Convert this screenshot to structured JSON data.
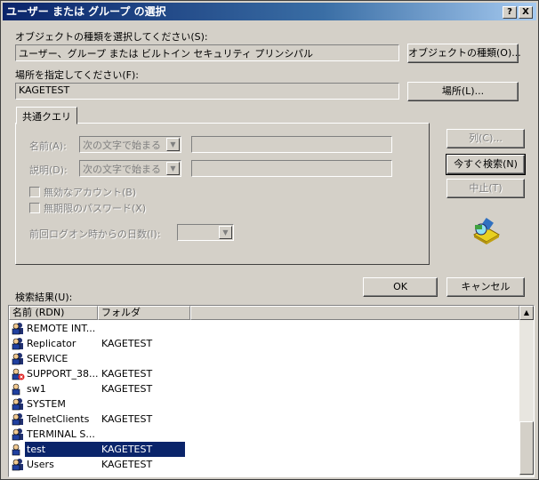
{
  "window": {
    "title": "ユーザー または グループ の選択",
    "help_btn": "?",
    "close_btn": "X"
  },
  "object_type": {
    "label": "オブジェクトの種類を選択してください(S):",
    "value": "ユーザー、グループ または ビルトイン セキュリティ プリンシパル",
    "button": "オブジェクトの種類(O)..."
  },
  "location": {
    "label": "場所を指定してください(F):",
    "value": "KAGETEST",
    "button": "場所(L)..."
  },
  "tab": {
    "label": "共通クエリ"
  },
  "query": {
    "name_label": "名前(A):",
    "name_mode": "次の文字で始まる",
    "name_value": "",
    "desc_label": "説明(D):",
    "desc_mode": "次の文字で始まる",
    "desc_value": "",
    "disabled_accounts": "無効なアカウント(B)",
    "no_expire_pwd": "無期限のパスワード(X)",
    "days_label": "前回ログオン時からの日数(I):",
    "days_value": ""
  },
  "buttons": {
    "columns": "列(C)...",
    "search_now": "今すぐ検索(N)",
    "stop": "中止(T)",
    "ok": "OK",
    "cancel": "キャンセル"
  },
  "results": {
    "label": "検索結果(U):",
    "columns": [
      "名前 (RDN)",
      "フォルダ"
    ],
    "rows": [
      {
        "name": "REMOTE INT...",
        "folder": "",
        "icon": "user-group-icon"
      },
      {
        "name": "Replicator",
        "folder": "KAGETEST",
        "icon": "user-group-icon"
      },
      {
        "name": "SERVICE",
        "folder": "",
        "icon": "user-group-icon"
      },
      {
        "name": "SUPPORT_38...",
        "folder": "KAGETEST",
        "icon": "disabled-user-icon"
      },
      {
        "name": "sw1",
        "folder": "KAGETEST",
        "icon": "user-icon"
      },
      {
        "name": "SYSTEM",
        "folder": "",
        "icon": "user-group-icon"
      },
      {
        "name": "TelnetClients",
        "folder": "KAGETEST",
        "icon": "user-group-icon"
      },
      {
        "name": "TERMINAL S...",
        "folder": "",
        "icon": "user-group-icon"
      },
      {
        "name": "test",
        "folder": "KAGETEST",
        "icon": "user-icon",
        "selected": true
      },
      {
        "name": "Users",
        "folder": "KAGETEST",
        "icon": "user-group-icon"
      }
    ]
  }
}
